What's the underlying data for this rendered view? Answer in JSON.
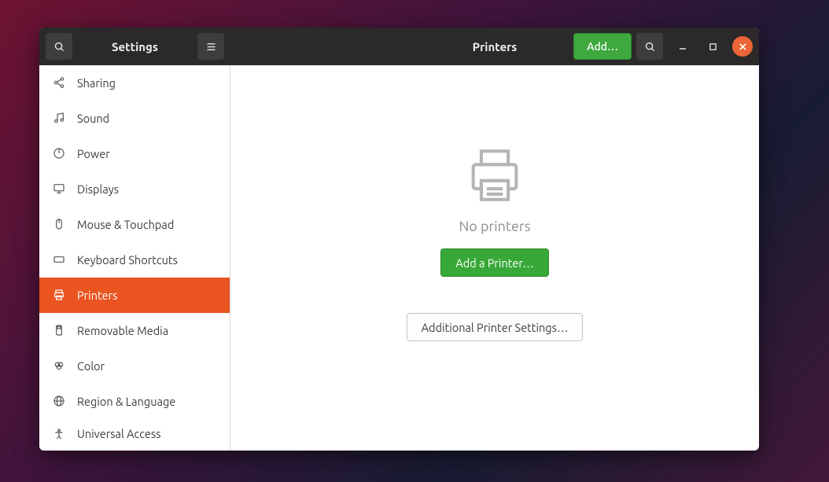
{
  "titlebar": {
    "left_title": "Settings",
    "right_title": "Printers",
    "add_label": "Add…"
  },
  "sidebar": {
    "items": [
      {
        "label": "Sharing",
        "icon": "share",
        "active": false
      },
      {
        "label": "Sound",
        "icon": "music",
        "active": false
      },
      {
        "label": "Power",
        "icon": "power",
        "active": false
      },
      {
        "label": "Displays",
        "icon": "display",
        "active": false
      },
      {
        "label": "Mouse & Touchpad",
        "icon": "mouse",
        "active": false
      },
      {
        "label": "Keyboard Shortcuts",
        "icon": "keyboard",
        "active": false
      },
      {
        "label": "Printers",
        "icon": "printer",
        "active": true
      },
      {
        "label": "Removable Media",
        "icon": "media",
        "active": false
      },
      {
        "label": "Color",
        "icon": "color",
        "active": false
      },
      {
        "label": "Region & Language",
        "icon": "globe",
        "active": false
      }
    ],
    "partial_next_label": "Universal Access"
  },
  "content": {
    "empty_text": "No printers",
    "add_printer_label": "Add a Printer…",
    "additional_settings_label": "Additional Printer Settings…"
  }
}
